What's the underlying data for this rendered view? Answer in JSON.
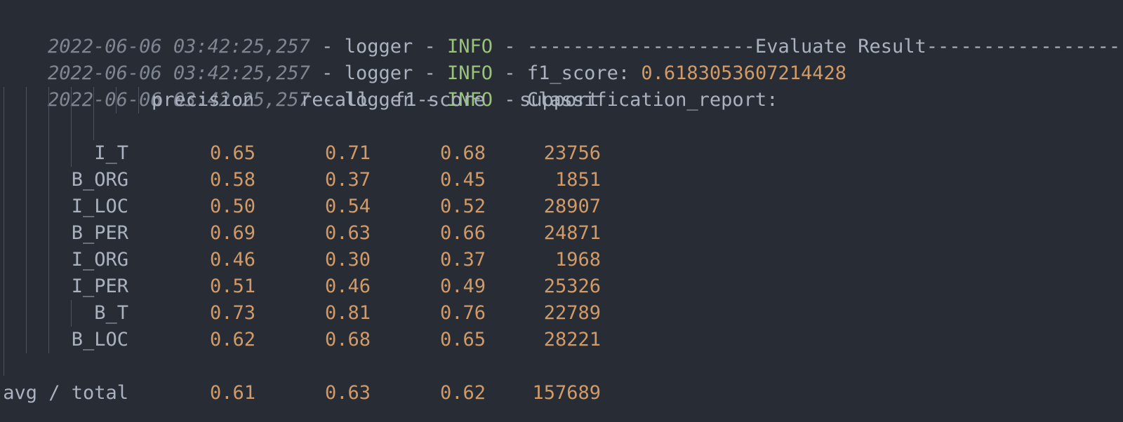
{
  "log": [
    {
      "timestamp": "2022-06-06 03:42:25,257",
      "sep1": " - ",
      "logger": "logger",
      "sep2": " - ",
      "level": "INFO",
      "sep3": " - ",
      "message": "--------------------Evaluate Result--------------------",
      "value": ""
    },
    {
      "timestamp": "2022-06-06 03:42:25,257",
      "sep1": " - ",
      "logger": "logger",
      "sep2": " - ",
      "level": "INFO",
      "sep3": " - ",
      "message": "f1_score: ",
      "value": "0.6183053607214428"
    },
    {
      "timestamp": "2022-06-06 03:42:25,257",
      "sep1": " - ",
      "logger": "logger",
      "sep2": " - ",
      "level": "INFO",
      "sep3": " - ",
      "message": "Classification_report:",
      "value": ""
    }
  ],
  "report": {
    "headers": [
      "precision",
      "recall",
      "f1-score",
      "support"
    ],
    "rows": [
      {
        "label": "I_T",
        "precision": "0.65",
        "recall": "0.71",
        "f1": "0.68",
        "support": "23756"
      },
      {
        "label": "B_ORG",
        "precision": "0.58",
        "recall": "0.37",
        "f1": "0.45",
        "support": "1851"
      },
      {
        "label": "I_LOC",
        "precision": "0.50",
        "recall": "0.54",
        "f1": "0.52",
        "support": "28907"
      },
      {
        "label": "B_PER",
        "precision": "0.69",
        "recall": "0.63",
        "f1": "0.66",
        "support": "24871"
      },
      {
        "label": "I_ORG",
        "precision": "0.46",
        "recall": "0.30",
        "f1": "0.37",
        "support": "1968"
      },
      {
        "label": "I_PER",
        "precision": "0.51",
        "recall": "0.46",
        "f1": "0.49",
        "support": "25326"
      },
      {
        "label": "B_T",
        "precision": "0.73",
        "recall": "0.81",
        "f1": "0.76",
        "support": "22789"
      },
      {
        "label": "B_LOC",
        "precision": "0.62",
        "recall": "0.68",
        "f1": "0.65",
        "support": "28221"
      }
    ],
    "total": {
      "label": "avg / total",
      "precision": "0.61",
      "recall": "0.63",
      "f1": "0.62",
      "support": "157689"
    }
  },
  "colors": {
    "background": "#282c34",
    "text": "#abb2bf",
    "timestamp": "#7f8692",
    "level": "#98c379",
    "number": "#d19a66",
    "guide": "#4b5263"
  }
}
